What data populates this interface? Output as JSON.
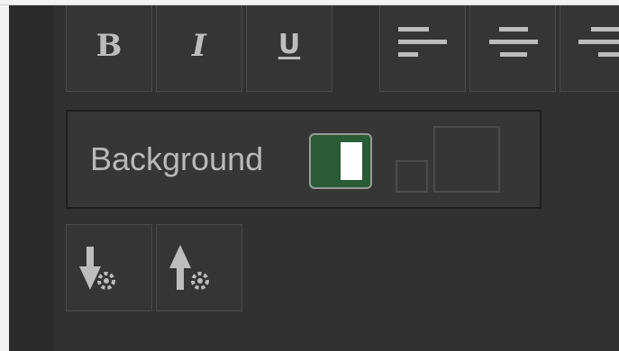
{
  "format_buttons": {
    "bold": "B",
    "italic": "I",
    "underline": "U"
  },
  "align_buttons": [
    "align-left-icon",
    "align-center-icon",
    "align-right-icon"
  ],
  "background": {
    "label": "Background",
    "swatch_color": "#2b5a37"
  },
  "order_buttons": [
    "move-down-icon",
    "move-up-icon"
  ]
}
